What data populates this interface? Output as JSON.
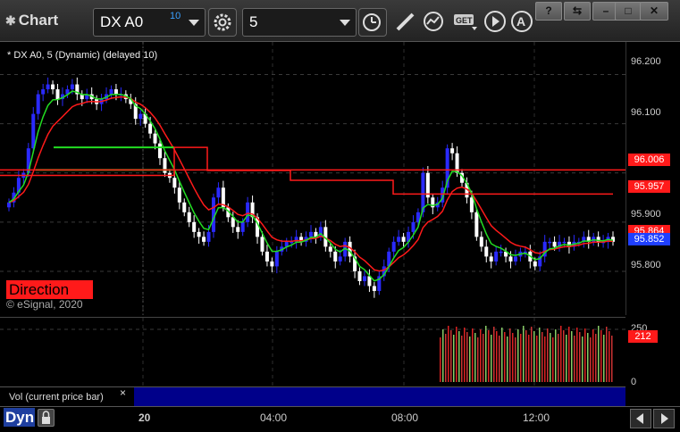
{
  "window": {
    "title": "Chart",
    "symbol": "DX A0",
    "symbol_badge": "10",
    "interval": "5",
    "help_btn": "?"
  },
  "chart": {
    "legend": "* DX A0, 5 (Dynamic) (delayed 10)",
    "direction_label": "Direction",
    "copyright": "© eSignal, 2020",
    "price_labels": [
      "96.200",
      "96.100",
      "96.000",
      "95.900",
      "95.800"
    ],
    "tags": {
      "tag1": "96.006",
      "tag2": "95.957",
      "tag3": "95.864",
      "tag4": "95.852"
    },
    "colors": {
      "up": "#2a2aff",
      "down": "#ffffff",
      "red_line": "#ff1a1a",
      "green_line": "#22dd22",
      "blue_tag": "#1f3fff"
    }
  },
  "volume": {
    "label": "Vol (current price bar)",
    "close": "×",
    "scale_labels": [
      "250",
      "0"
    ],
    "tag": "212"
  },
  "xaxis": {
    "dyn_label": "Dyn",
    "labels": [
      "20",
      "04:00",
      "08:00",
      "12:00"
    ]
  },
  "chart_data": {
    "type": "candlestick",
    "ylim": [
      95.74,
      96.23
    ],
    "x_labels": [
      "20",
      "04:00",
      "08:00",
      "12:00"
    ],
    "y_ticks": [
      96.2,
      96.1,
      96.0,
      95.9,
      95.8
    ],
    "close": [
      95.94,
      95.96,
      95.99,
      96.0,
      96.05,
      96.12,
      96.16,
      96.17,
      96.18,
      96.17,
      96.15,
      96.16,
      96.17,
      96.18,
      96.16,
      96.15,
      96.16,
      96.15,
      96.14,
      96.15,
      96.16,
      96.17,
      96.16,
      96.16,
      96.15,
      96.14,
      96.11,
      96.12,
      96.1,
      96.08,
      96.06,
      96.03,
      96.0,
      95.99,
      95.97,
      95.94,
      95.92,
      95.9,
      95.88,
      95.87,
      95.86,
      95.88,
      95.95,
      95.97,
      95.93,
      95.91,
      95.89,
      95.88,
      95.9,
      95.94,
      95.91,
      95.87,
      95.84,
      95.82,
      95.81,
      95.84,
      95.85,
      95.86,
      95.86,
      95.87,
      95.86,
      95.87,
      95.88,
      95.87,
      95.89,
      95.85,
      95.84,
      95.82,
      95.83,
      95.86,
      95.83,
      95.8,
      95.78,
      95.79,
      95.77,
      95.76,
      95.79,
      95.81,
      95.84,
      95.86,
      95.87,
      95.86,
      95.88,
      95.9,
      95.92,
      96.0,
      95.95,
      95.93,
      95.94,
      95.97,
      96.05,
      96.04,
      96.0,
      95.98,
      95.95,
      95.92,
      95.87,
      95.85,
      95.83,
      95.82,
      95.84,
      95.84,
      95.83,
      95.82,
      95.83,
      95.84,
      95.84,
      95.82,
      95.81,
      95.83,
      95.86,
      95.86,
      95.85,
      95.86,
      95.86,
      95.85,
      95.86,
      95.86,
      95.87,
      95.86,
      95.87,
      95.86,
      95.86,
      95.87,
      95.86
    ],
    "series": [
      {
        "name": "red",
        "values": [
          96.006,
          95.957
        ]
      },
      {
        "name": "green"
      }
    ],
    "volume": {
      "ylim": [
        0,
        250
      ],
      "last": 212
    }
  }
}
